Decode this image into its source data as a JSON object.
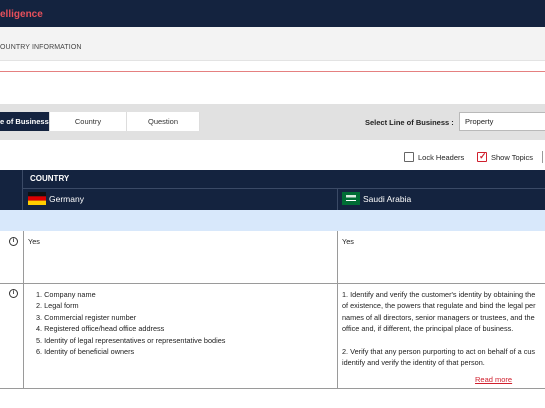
{
  "header": {
    "brand": "elligence"
  },
  "breadcrumb": "OUNTRY INFORMATION",
  "tabs": [
    {
      "label": "e of Business",
      "active": true
    },
    {
      "label": "Country",
      "active": false
    },
    {
      "label": "Question",
      "active": false
    }
  ],
  "line_of_business": {
    "label": "Select Line of Business :",
    "value": "Property"
  },
  "options": [
    {
      "label": "Lock Headers",
      "checked": false
    },
    {
      "label": "Show Topics",
      "checked": true
    }
  ],
  "table": {
    "header": "COUNTRY",
    "countries": [
      {
        "name": "Germany",
        "flag": "germany-flag"
      },
      {
        "name": "Saudi Arabia",
        "flag": "saudi-arabia-flag"
      }
    ],
    "rows": [
      {
        "germany": "Yes",
        "saudi": "Yes"
      },
      {
        "germany_items": [
          "1. Company name",
          "2. Legal form",
          "3. Commercial register number",
          "4. Registered office/head office address",
          "5. Identity of legal representatives or representative bodies",
          "6. Identity of beneficial owners"
        ],
        "saudi_lines": [
          "1. Identify and verify the customer's identity by obtaining the",
          "of existence, the powers that regulate and bind the legal per",
          "names of all directors, senior managers or trustees, and the",
          "office and, if different, the principal place of business.",
          "",
          "2. Verify that any person purporting to act on behalf of a cus",
          "identify and verify the identity of that person."
        ],
        "read_more": "Read more"
      }
    ]
  },
  "colors": {
    "navy": "#14233f",
    "accent_red": "#d0202e",
    "band_blue": "#d8e8fb"
  }
}
